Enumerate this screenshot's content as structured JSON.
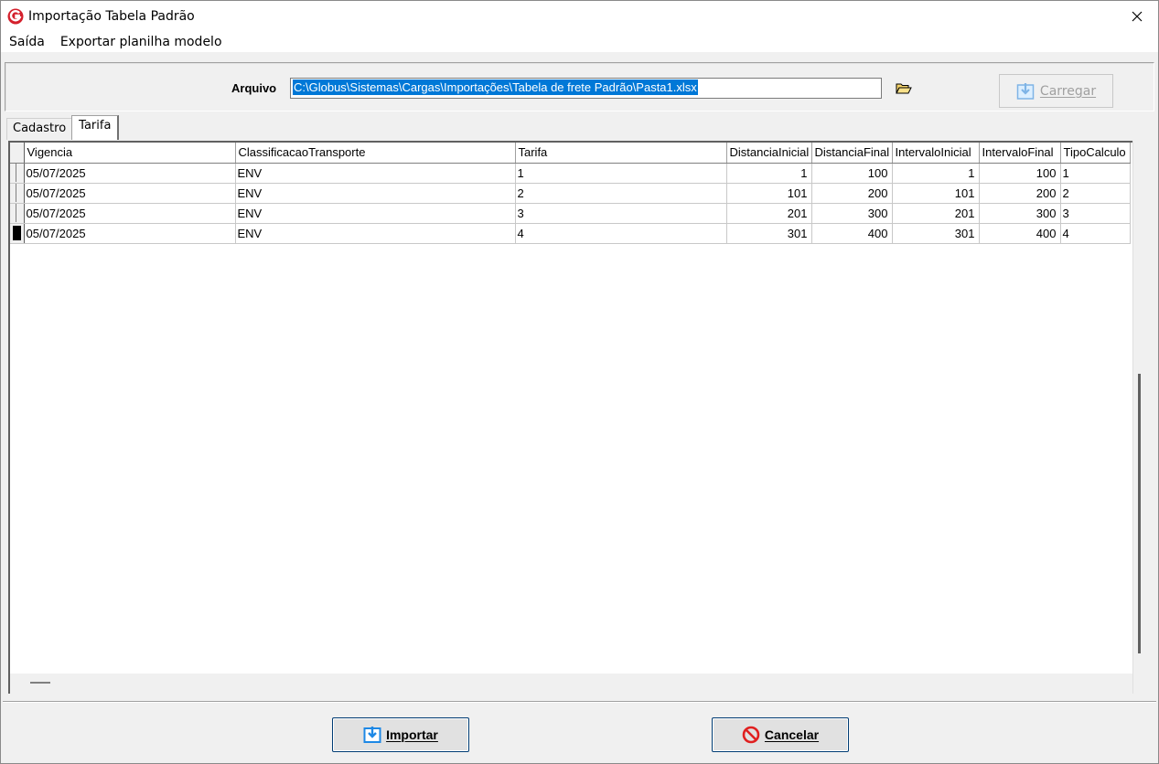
{
  "window": {
    "title": "Importação Tabela Padrão",
    "close_glyph": "✕"
  },
  "menu": {
    "items": [
      "Saída",
      "Exportar planilha modelo"
    ]
  },
  "file": {
    "label": "Arquivo",
    "path": "C:\\Globus\\Sistemas\\Cargas\\Importações\\Tabela de frete Padrão\\Pasta1.xlsx",
    "folder_icon": "folder-open-icon",
    "load_button": "Carregar",
    "load_enabled": false
  },
  "tabs": [
    {
      "label": "Cadastro",
      "active": false
    },
    {
      "label": "Tarifa",
      "active": true
    }
  ],
  "grid": {
    "columns": [
      "Vigencia",
      "ClassificacaoTransporte",
      "Tarifa",
      "DistanciaInicial",
      "DistanciaFinal",
      "IntervaloInicial",
      "IntervaloFinal",
      "TipoCalculo"
    ],
    "rows": [
      [
        "05/07/2025",
        "ENV",
        "1",
        "1",
        "100",
        "1",
        "100",
        "1"
      ],
      [
        "05/07/2025",
        "ENV",
        "2",
        "101",
        "200",
        "101",
        "200",
        "2"
      ],
      [
        "05/07/2025",
        "ENV",
        "3",
        "201",
        "300",
        "201",
        "300",
        "3"
      ],
      [
        "05/07/2025",
        "ENV",
        "4",
        "301",
        "400",
        "301",
        "400",
        "4"
      ]
    ],
    "current_row": 3
  },
  "actions": {
    "import_button": "Importar",
    "cancel_button": "Cancelar"
  },
  "colors": {
    "selection": "#0078d7",
    "brand_red": "#d4202c",
    "import_icon_blue": "#1e88e5",
    "cancel_icon_red": "#e02020"
  }
}
